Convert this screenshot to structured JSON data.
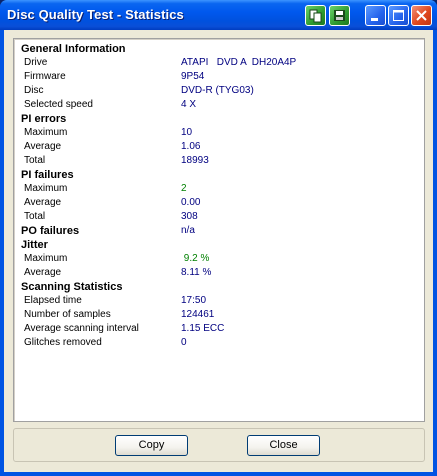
{
  "window": {
    "title": "Disc Quality Test - Statistics"
  },
  "titlebar": {
    "buttons": [
      {
        "icon": "copy-icon"
      },
      {
        "icon": "save-icon"
      },
      {
        "icon": "minimize-icon"
      },
      {
        "icon": "maximize-icon"
      },
      {
        "icon": "close-icon"
      }
    ]
  },
  "sections": {
    "general": {
      "heading": "General Information",
      "rows": [
        {
          "label": "Drive",
          "value": "ATAPI   DVD A  DH20A4P"
        },
        {
          "label": "Firmware",
          "value": "9P54"
        },
        {
          "label": "Disc",
          "value": "DVD-R (TYG03)"
        },
        {
          "label": "Selected speed",
          "value": "4 X"
        }
      ]
    },
    "pi_errors": {
      "heading": "PI errors",
      "rows": [
        {
          "label": "Maximum",
          "value": "10"
        },
        {
          "label": "Average",
          "value": "1.06"
        },
        {
          "label": "Total",
          "value": "18993"
        }
      ]
    },
    "pi_failures": {
      "heading": "PI failures",
      "rows": [
        {
          "label": "Maximum",
          "value": "2"
        },
        {
          "label": "Average",
          "value": "0.00"
        },
        {
          "label": "Total",
          "value": "308"
        }
      ]
    },
    "po_failures": {
      "heading": "PO failures",
      "value": "n/a"
    },
    "jitter": {
      "heading": "Jitter",
      "rows": [
        {
          "label": "Maximum",
          "value": " 9.2 %"
        },
        {
          "label": "Average",
          "value": "8.11 %"
        }
      ]
    },
    "scanning": {
      "heading": "Scanning Statistics",
      "rows": [
        {
          "label": "Elapsed time",
          "value": "17:50"
        },
        {
          "label": "Number of samples",
          "value": "124461"
        },
        {
          "label": "Average scanning interval",
          "value": "1.15 ECC"
        },
        {
          "label": "Glitches removed",
          "value": "0"
        }
      ]
    }
  },
  "colors": {
    "value_text": "#000080",
    "highlight_text": "#008000"
  },
  "buttons": {
    "copy": "Copy",
    "close": "Close"
  }
}
